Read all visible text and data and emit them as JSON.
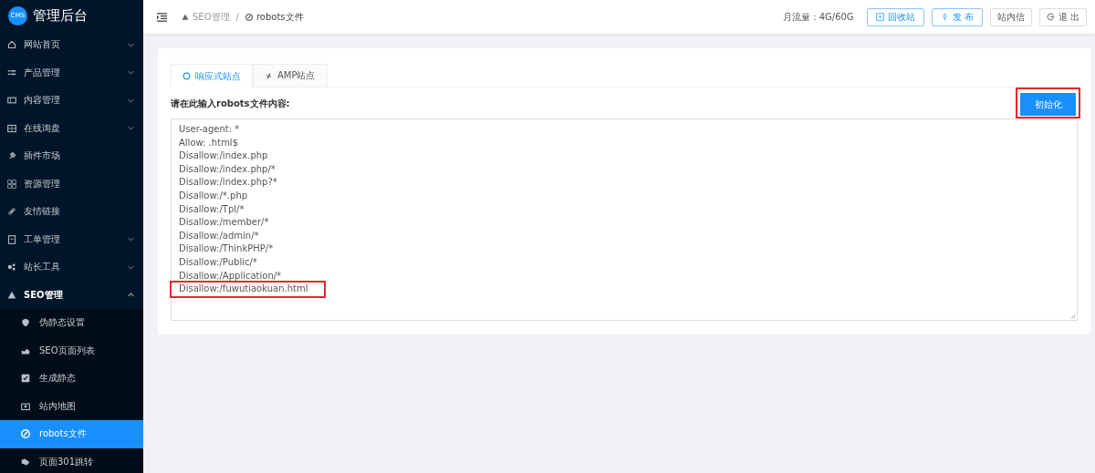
{
  "brand": {
    "logo": "CMS",
    "title": "管理后台"
  },
  "sidebar": {
    "items": [
      {
        "label": "网站首页",
        "expanded": false,
        "selected": false
      },
      {
        "label": "产品管理",
        "expanded": false,
        "selected": false
      },
      {
        "label": "内容管理",
        "expanded": false,
        "selected": false
      },
      {
        "label": "在线询盘",
        "expanded": false,
        "selected": false
      },
      {
        "label": "插件市场",
        "selected": false
      },
      {
        "label": "资源管理",
        "selected": false
      },
      {
        "label": "友情链接",
        "selected": false
      },
      {
        "label": "工单管理",
        "expanded": false,
        "selected": false
      },
      {
        "label": "站长工具",
        "expanded": false,
        "selected": false
      },
      {
        "label": "SEO管理",
        "expanded": true,
        "selected": false,
        "children": [
          {
            "label": "伪静态设置",
            "selected": false
          },
          {
            "label": "SEO页面列表",
            "selected": false
          },
          {
            "label": "生成静态",
            "selected": false
          },
          {
            "label": "站内地图",
            "selected": false
          },
          {
            "label": "robots文件",
            "selected": true
          },
          {
            "label": "页面301跳转",
            "selected": false
          }
        ]
      }
    ]
  },
  "breadcrumb": [
    "SEO管理",
    "robots文件"
  ],
  "breadcrumb_separator": "/",
  "header": {
    "traffic": "月流量：4G/60G",
    "buttons": [
      {
        "label": "回收站",
        "kind": "primary"
      },
      {
        "label": "发 布",
        "kind": "primary"
      },
      {
        "label": "站内信",
        "kind": "plain"
      },
      {
        "label": "退 出",
        "kind": "plain"
      }
    ]
  },
  "tabs": [
    {
      "label": "响应式站点",
      "selected": true
    },
    {
      "label": "AMP站点",
      "selected": false
    }
  ],
  "form": {
    "label": "请在此输入robots文件内容:",
    "init_button": {
      "label": "初始化",
      "highlighted": true
    },
    "lines": [
      {
        "text": "User-agent: *",
        "highlighted": false
      },
      {
        "text": "Allow: .html$",
        "highlighted": false
      },
      {
        "text": "Disallow:/index.php",
        "highlighted": false
      },
      {
        "text": "Disallow:/index.php/*",
        "highlighted": false
      },
      {
        "text": "Disallow:/index.php?*",
        "highlighted": false
      },
      {
        "text": "Disallow:/*.php",
        "highlighted": false
      },
      {
        "text": "Disallow:/Tpl/*",
        "highlighted": false
      },
      {
        "text": "Disallow:/member/*",
        "highlighted": false
      },
      {
        "text": "Disallow:/admin/*",
        "highlighted": false
      },
      {
        "text": "Disallow:/ThinkPHP/*",
        "highlighted": false
      },
      {
        "text": "Disallow:/Public/*",
        "highlighted": false
      },
      {
        "text": "Disallow:/Application/*",
        "highlighted": false
      },
      {
        "text": "Disallow:/fuwutiaokuan.html",
        "highlighted": true
      }
    ]
  }
}
